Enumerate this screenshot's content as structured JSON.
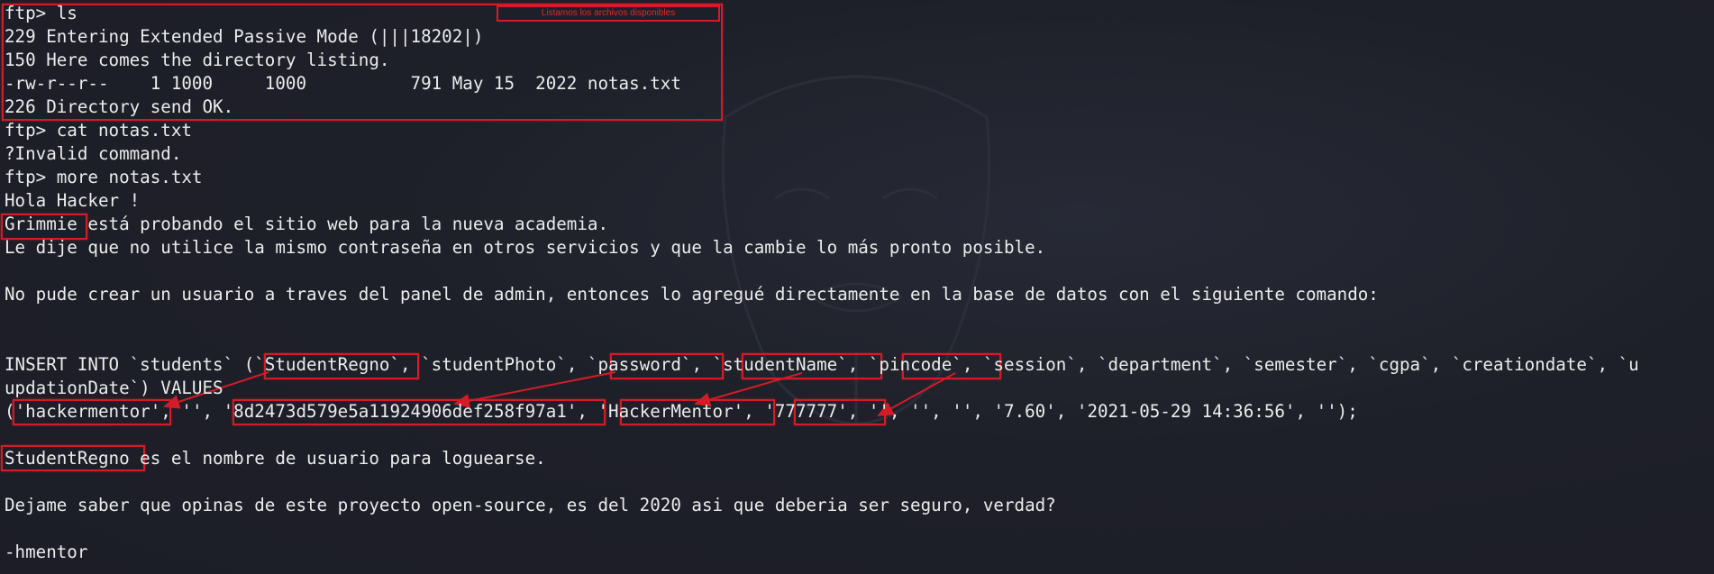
{
  "annotation": {
    "note": "Listamos los archivos disponibles",
    "color": "#d31c28"
  },
  "terminal": {
    "background": "#1d1f29",
    "text_color": "#ececec",
    "lines": [
      "ftp> ls",
      "229 Entering Extended Passive Mode (|||18202|)",
      "150 Here comes the directory listing.",
      "-rw-r--r--    1 1000     1000          791 May 15  2022 notas.txt",
      "226 Directory send OK.",
      "ftp> cat notas.txt",
      "?Invalid command.",
      "ftp> more notas.txt",
      "Hola Hacker !",
      "",
      "Le dije que no utilice la mismo contraseña en otros servicios y que la cambie lo más pronto posible.",
      "",
      "No pude crear un usuario a traves del panel de admin, entonces lo agregué directamente en la base de datos con el siguiente comando:",
      "",
      "",
      "",
      "updationDate`) VALUES",
      "",
      "",
      "",
      "",
      "Dejame saber que opinas de este proyecto open-source, es del 2020 asi que deberia ser seguro, verdad?",
      "",
      "-hmentor"
    ],
    "grimmie_line": {
      "name": "Grimmie",
      "rest": " está probando el sitio web para la nueva academia."
    },
    "insert_line": {
      "p0": "INSERT INTO `students` (",
      "col1": "`StudentRegno`",
      "p1": ", `studentPhoto`, ",
      "col2": "`password`",
      "p2": ", ",
      "col3": "`studentName`",
      "p3": ", ",
      "col4": "`pincode`",
      "p4": ", `session`, `department`, `semester`, `cgpa`, `creationdate`, `u"
    },
    "values_line": {
      "p0": "(",
      "v1": "'hackermentor'",
      "p1": ", '', ",
      "v2": "'8d2473d579e5a11924906def258f97a1'",
      "p2": ", ",
      "v3": "'HackerMentor'",
      "p3": ", ",
      "v4": "'777777'",
      "p4": ", '', '', '', '7.60', '2021-05-29 14:36:56', '');"
    },
    "regno_line": {
      "name": "StudentRegno",
      "rest": " es el nombre de usuario para loguearse."
    }
  }
}
